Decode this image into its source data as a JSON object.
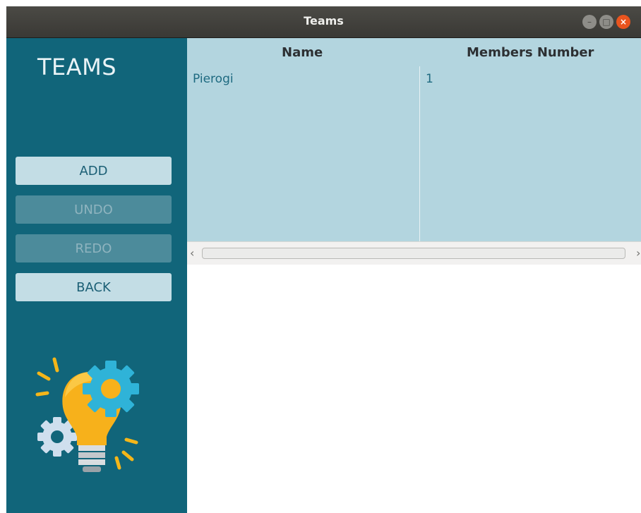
{
  "window": {
    "title": "Teams"
  },
  "sidebar": {
    "title": "TEAMS",
    "buttons": {
      "add": "ADD",
      "undo": "UNDO",
      "redo": "REDO",
      "back": "BACK"
    },
    "illustration_icon": "lightbulb-gears-icon"
  },
  "table": {
    "columns": [
      "Name",
      "Members Number"
    ],
    "rows": [
      {
        "name": "Pierogi",
        "members": "1"
      }
    ]
  },
  "colors": {
    "sidebar_bg": "#11657a",
    "table_bg": "#b3d5df",
    "button_active": "#c3dde5",
    "button_disabled": "#4c8b9b",
    "titlebar_bg": "#3f3e3a",
    "close_button": "#e9541e"
  }
}
